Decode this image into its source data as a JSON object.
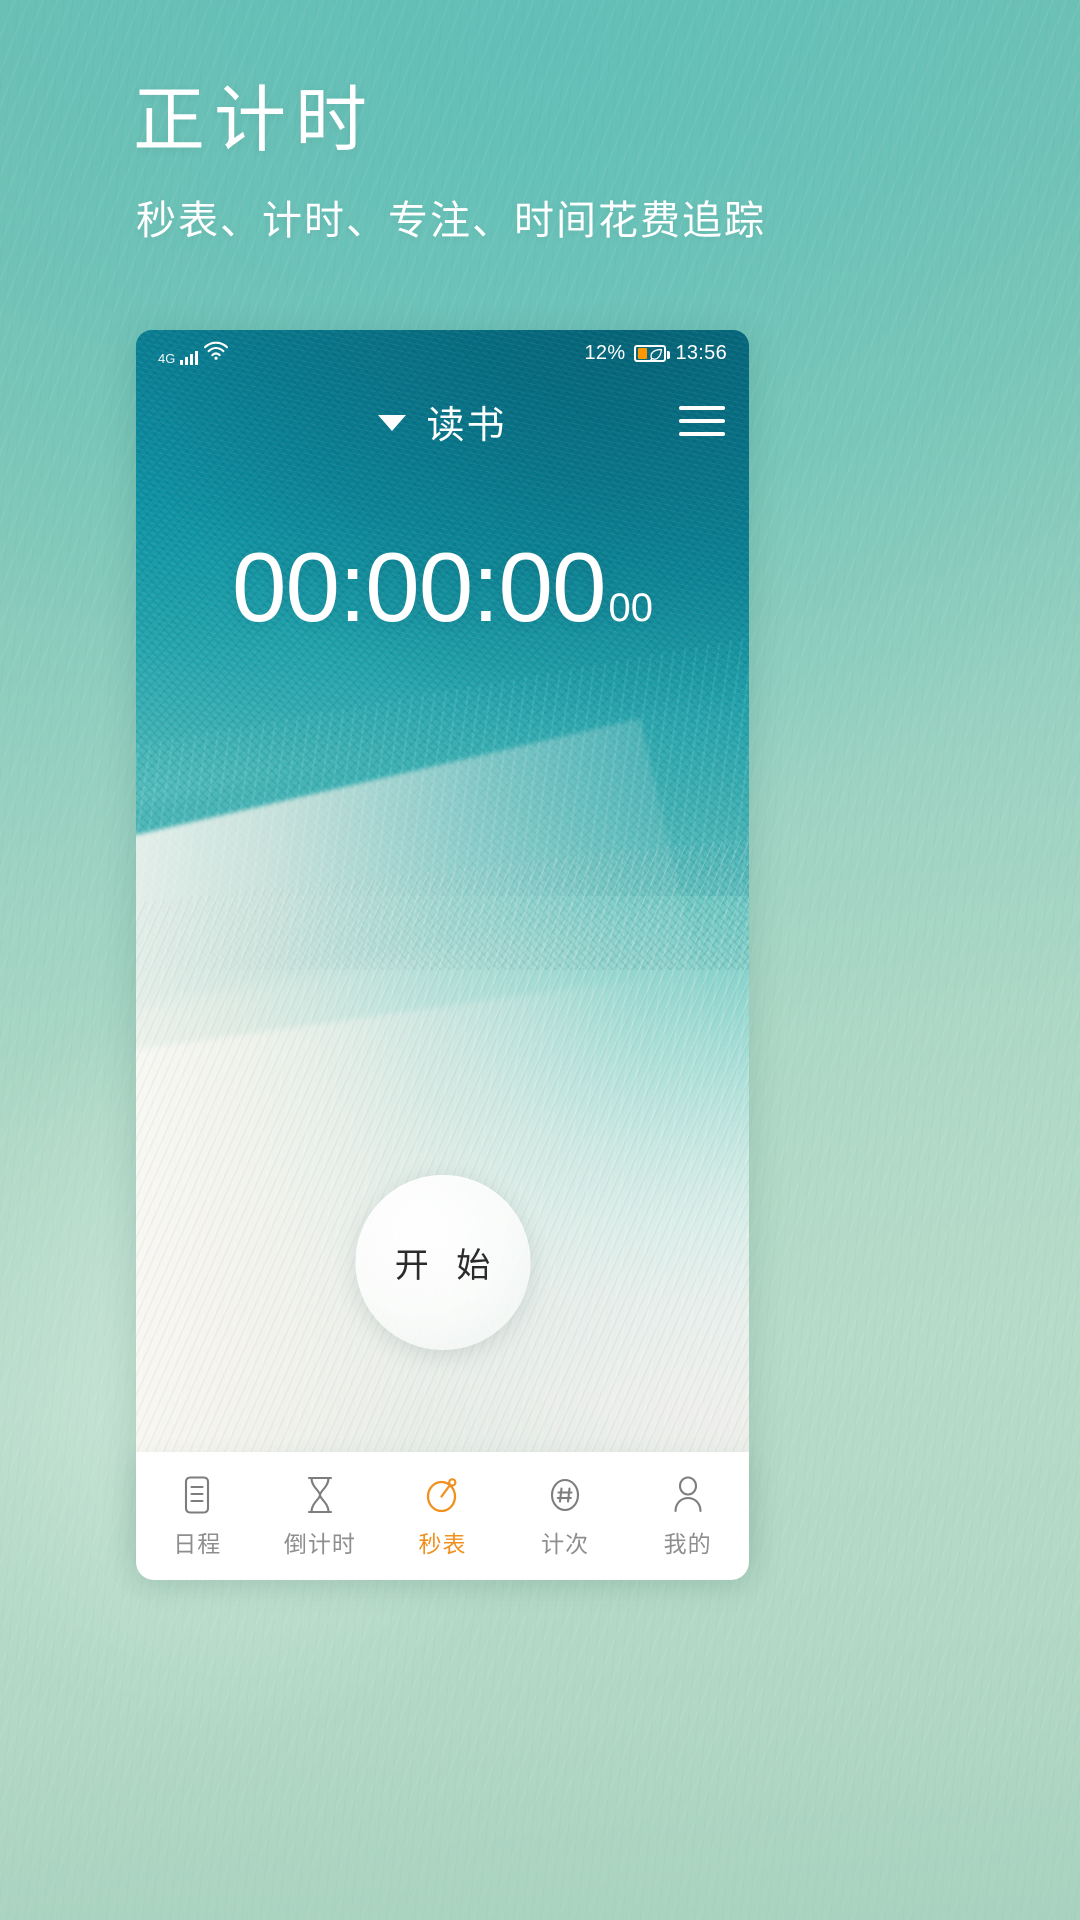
{
  "promo": {
    "title": "正计时",
    "subtitle": "秒表、计时、专注、时间花费追踪",
    "title_color": "#ffffff",
    "background_color": "#8ecabc"
  },
  "status_bar": {
    "network_label": "4G",
    "signal_icon": "signal-bars-icon",
    "wifi_icon": "wifi-icon",
    "battery_percent": "12%",
    "battery_fill_color": "#ff9800",
    "battery_saver_icon": "leaf-icon",
    "clock": "13:56"
  },
  "app_header": {
    "caret_icon": "chevron-down-icon",
    "task_name": "读书",
    "menu_icon": "hamburger-menu-icon"
  },
  "timer": {
    "main": "00:00:00",
    "centiseconds": "00",
    "hours": "00",
    "minutes": "00",
    "seconds": "00"
  },
  "start_button": {
    "label": "开 始",
    "state": "stopped"
  },
  "bottom_nav": {
    "active_index": 2,
    "active_color": "#f0901f",
    "inactive_color": "#8e8e8e",
    "items": [
      {
        "label": "日程",
        "icon": "schedule-list-icon"
      },
      {
        "label": "倒计时",
        "icon": "hourglass-icon"
      },
      {
        "label": "秒表",
        "icon": "stopwatch-icon"
      },
      {
        "label": "计次",
        "icon": "counter-hash-icon"
      },
      {
        "label": "我的",
        "icon": "person-profile-icon"
      }
    ]
  }
}
